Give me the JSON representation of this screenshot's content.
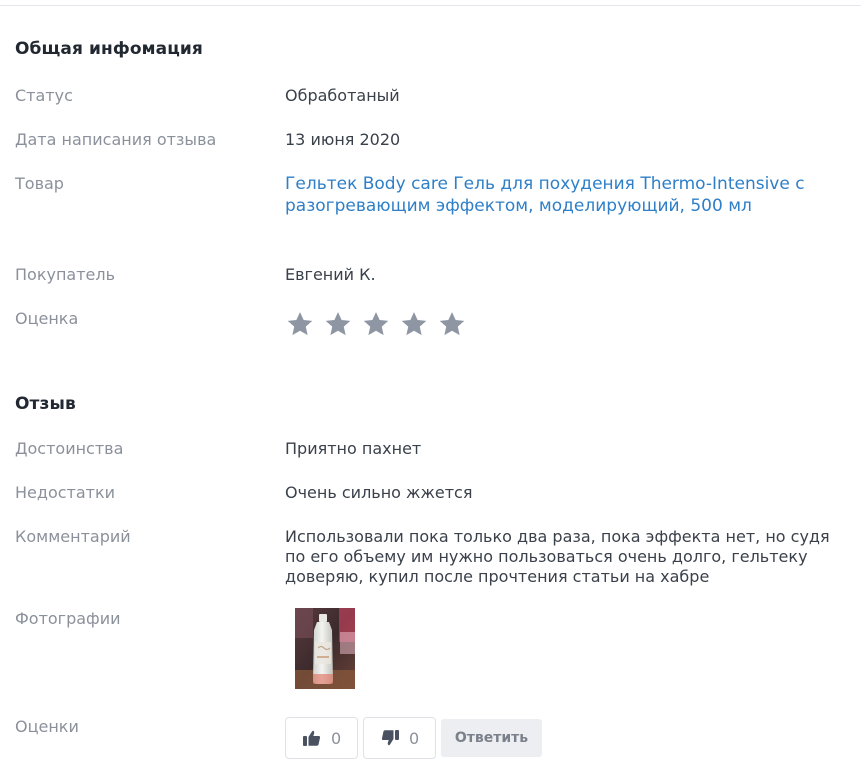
{
  "general": {
    "title": "Общая инфомация",
    "status_label": "Статус",
    "status_value": "Обработаный",
    "date_label": "Дата написания отзыва",
    "date_value": "13 июня 2020",
    "product_label": "Товар",
    "product_value": "Гельтек Body care Гель для похудения Thermo-Intensive с разогревающим эффектом, моделирующий, 500 мл",
    "buyer_label": "Покупатель",
    "buyer_value": "Евгений К.",
    "rating_label": "Оценка",
    "rating_stars_max": 5,
    "star_color": "#8e95a3"
  },
  "review": {
    "title": "Отзыв",
    "pros_label": "Достоинства",
    "pros_value": "Приятно пахнет",
    "cons_label": "Недостатки",
    "cons_value": "Очень сильно жжется",
    "comment_label": "Комментарий",
    "comment_value": "Использовали пока только два раза, пока эффекта нет, но судя по его объему им нужно пользоваться очень долго, гельтеку доверяю, купил после прочтения статьи на хабре",
    "photos_label": "Фотографии",
    "votes_label": "Оценки",
    "likes": "0",
    "dislikes": "0",
    "reply_label": "Ответить"
  },
  "colors": {
    "link": "#2e7fc8",
    "label": "#8b919b",
    "text": "#3a414b"
  }
}
